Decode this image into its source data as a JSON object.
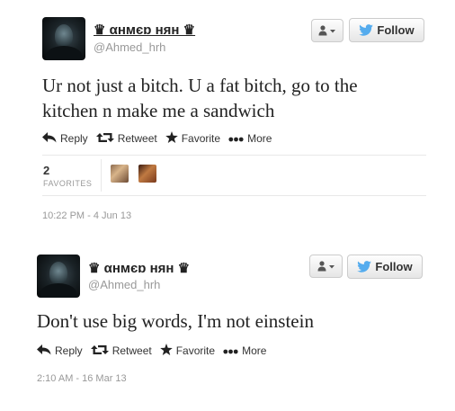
{
  "tweets": [
    {
      "display_name": "♛ αнмєɒ нян ♛",
      "handle": "@Ahmed_hrh",
      "follow_label": "Follow",
      "text_line1": "Ur not just a bitch. U a fat bitch, go to the",
      "text_line2": "kitchen n make me a sandwich",
      "actions": {
        "reply": "Reply",
        "retweet": "Retweet",
        "favorite": "Favorite",
        "more": "More"
      },
      "favorites_count": "2",
      "favorites_label": "FAVORITES",
      "timestamp": "10:22 PM - 4 Jun 13"
    },
    {
      "display_name": "♛ αнмєɒ нян ♛",
      "handle": "@Ahmed_hrh",
      "follow_label": "Follow",
      "text_line1": "Don't use big words, I'm not einstein",
      "actions": {
        "reply": "Reply",
        "retweet": "Retweet",
        "favorite": "Favorite",
        "more": "More"
      },
      "timestamp": "2:10 AM - 16 Mar 13"
    }
  ],
  "colors": {
    "twitter_bird": "#55acee",
    "text": "#222222",
    "muted": "#999999"
  },
  "icons": [
    "person-dropdown-icon",
    "twitter-bird-icon",
    "reply-arrow-icon",
    "retweet-icon",
    "star-icon",
    "more-dots-icon"
  ]
}
